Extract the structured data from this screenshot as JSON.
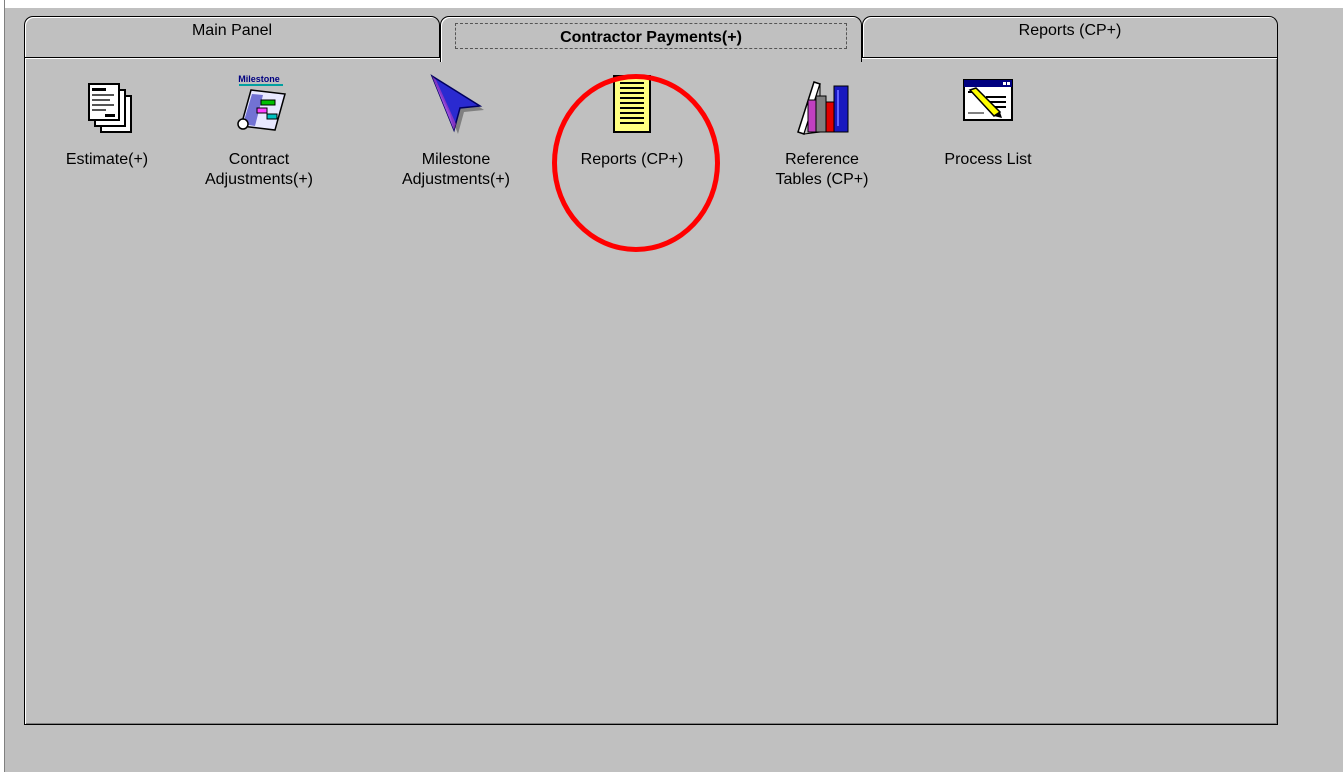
{
  "tabs": [
    {
      "label": "Main Panel",
      "active": false
    },
    {
      "label": "Contractor Payments(+)",
      "active": true
    },
    {
      "label": "Reports (CP+)",
      "active": false
    }
  ],
  "launchers": [
    {
      "label": "Estimate(+)",
      "icon": "estimate-documents-icon"
    },
    {
      "label": "Contract\nAdjustments(+)",
      "icon": "milestone-chart-icon",
      "icon_caption": "Milestone"
    },
    {
      "label": "Milestone\nAdjustments(+)",
      "icon": "arrow-cursor-icon"
    },
    {
      "label": "Reports (CP+)",
      "icon": "report-page-icon"
    },
    {
      "label": "Reference\nTables (CP+)",
      "icon": "books-icon"
    },
    {
      "label": "Process List",
      "icon": "window-pencil-icon"
    }
  ],
  "annotation": {
    "color": "#ff0000",
    "target": "Reports (CP+)"
  }
}
